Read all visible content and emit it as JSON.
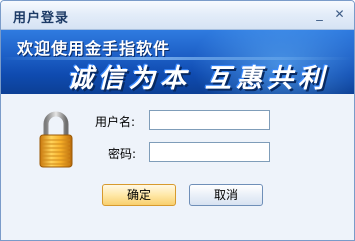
{
  "window": {
    "title": "用户登录",
    "minimize_glyph": "_",
    "close_glyph": "✕"
  },
  "banner": {
    "line1": "欢迎使用金手指软件",
    "line2": "诚信为本 互惠共利"
  },
  "form": {
    "username_label": "用户名:",
    "username_value": "",
    "password_label": "密码:",
    "password_value": ""
  },
  "buttons": {
    "ok_label": "确定",
    "cancel_label": "取消"
  },
  "icons": {
    "lock": "padlock-icon"
  },
  "colors": {
    "banner_blue": "#1d5fc6",
    "lock_gold": "#f0a020",
    "ok_button": "#ffe8a8"
  }
}
